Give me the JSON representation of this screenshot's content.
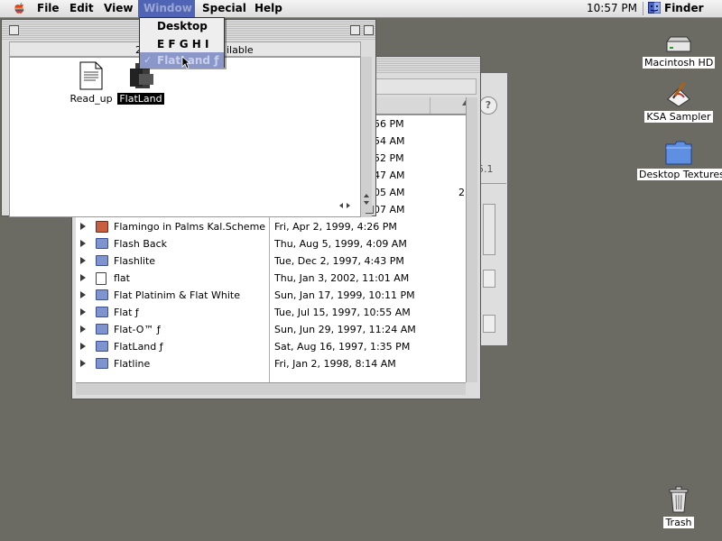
{
  "menubar": {
    "items": [
      "File",
      "Edit",
      "View",
      "Window",
      "Special",
      "Help"
    ],
    "active_item": "Window",
    "clock": "10:57 PM",
    "app_name": "Finder"
  },
  "window_menu": {
    "items": [
      {
        "label": "Desktop",
        "checked": false
      },
      {
        "label": "E F G H I",
        "checked": false
      },
      {
        "label": "FlatLand ƒ",
        "checked": true
      }
    ],
    "check_mark": "✓"
  },
  "icon_window": {
    "info_left": "2",
    "info_right": "ilable",
    "icons": [
      {
        "label": "Read_up",
        "type": "document"
      },
      {
        "label": "FlatLand",
        "type": "application",
        "selected": true
      }
    ]
  },
  "list_window": {
    "partial_times": [
      "56 PM",
      "54 AM",
      "52 PM",
      "47 AM",
      "05 AM",
      "07 AM"
    ],
    "right_fragments": [
      "2",
      "5.1"
    ],
    "rows": [
      {
        "name": "Flamingo in Palms Kal.Scheme",
        "date": "Fri, Apr 2, 1999, 4:26 PM",
        "icon": "pic"
      },
      {
        "name": "Flash Back",
        "date": "Thu, Aug 5, 1999, 4:09 AM",
        "icon": "folder"
      },
      {
        "name": "Flashlite",
        "date": "Tue, Dec 2, 1997, 4:43 PM",
        "icon": "folder"
      },
      {
        "name": "flat",
        "date": "Thu, Jan 3, 2002, 11:01 AM",
        "icon": "doc"
      },
      {
        "name": "Flat Platinim & Flat White",
        "date": "Sun, Jan 17, 1999, 10:11 PM",
        "icon": "folder"
      },
      {
        "name": "Flat ƒ",
        "date": "Tue, Jul 15, 1997, 10:55 AM",
        "icon": "folder"
      },
      {
        "name": "Flat-O™ ƒ",
        "date": "Sun, Jun 29, 1997, 11:24 AM",
        "icon": "folder"
      },
      {
        "name": "FlatLand ƒ",
        "date": "Sat, Aug 16, 1997, 1:35 PM",
        "icon": "folder"
      },
      {
        "name": "Flatline",
        "date": "Fri, Jan 2, 1998, 8:14 AM",
        "icon": "folder"
      }
    ]
  },
  "desktop": {
    "icons": [
      {
        "label": "Macintosh HD",
        "icon": "hard-disk"
      },
      {
        "label": "KSA Sampler",
        "icon": "sampler"
      },
      {
        "label": "Desktop Textures",
        "icon": "folder"
      },
      {
        "label": "Trash",
        "icon": "trash"
      }
    ]
  },
  "colors": {
    "desktop": "#6b6b63",
    "menu_highlight": "#4f64b4",
    "folder": "#7f93cf"
  }
}
